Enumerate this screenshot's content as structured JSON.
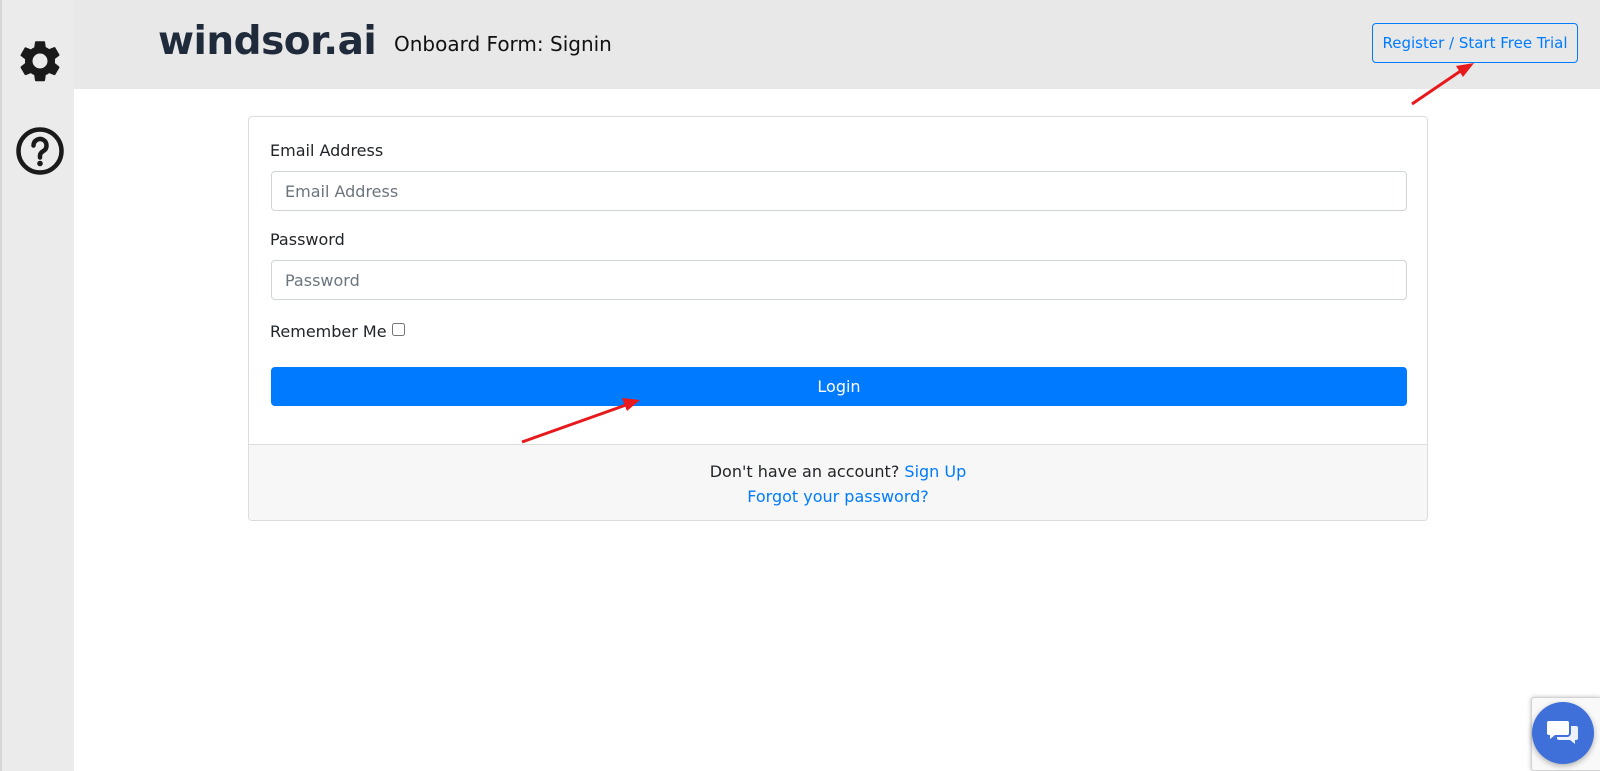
{
  "sidebar": {
    "icons": [
      "gear-icon",
      "question-circle-icon"
    ]
  },
  "header": {
    "logo": "windsor.ai",
    "title": "Onboard Form: Signin",
    "register_button": "Register / Start Free Trial"
  },
  "form": {
    "email_label": "Email Address",
    "email_placeholder": "Email Address",
    "email_value": "",
    "password_label": "Password",
    "password_placeholder": "Password",
    "password_value": "",
    "remember_label": "Remember Me",
    "remember_checked": false,
    "login_button": "Login"
  },
  "footer": {
    "no_account_text": "Don't have an account?",
    "signup_link": "Sign Up",
    "forgot_link": "Forgot your password?"
  },
  "widgets": {
    "chat_icon": "chat-bubbles-icon"
  },
  "colors": {
    "primary": "#007bff",
    "annotation_arrow": "#e8191c",
    "chat": "#3f6fd8"
  }
}
